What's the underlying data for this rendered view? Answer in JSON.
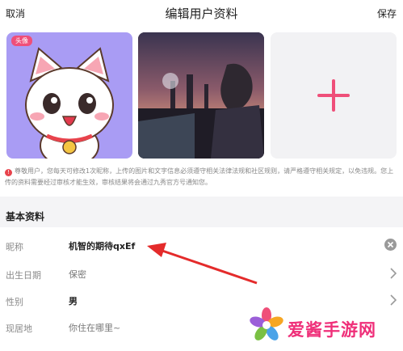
{
  "header": {
    "cancel_label": "取消",
    "title": "编辑用户资料",
    "save_label": "保存"
  },
  "photos": {
    "avatar_tag": "头像"
  },
  "notice": {
    "text": "尊敬用户，您每天可修改1次昵称，上传的图片和文字信息必须遵守相关法律法规和社区规则，请严格遵守相关规定，以免违规。您上传的资料需要经过审核才能生效，审核结果将会通过九秀官方号通知您。"
  },
  "section": {
    "title": "基本资料"
  },
  "fields": {
    "nickname": {
      "label": "昵称",
      "value": "机智的期待qxEf"
    },
    "birthday": {
      "label": "出生日期",
      "value": "保密"
    },
    "gender": {
      "label": "性别",
      "value": "男"
    },
    "location": {
      "label": "现居地",
      "placeholder": "你住在哪里~"
    }
  },
  "watermark": {
    "text": "爱酱手游网"
  },
  "colors": {
    "accent_pink": "#ef4f79",
    "background_gray": "#f4f4f6",
    "notice_icon_red": "#e8434c",
    "arrow_red": "#e42b2b"
  }
}
